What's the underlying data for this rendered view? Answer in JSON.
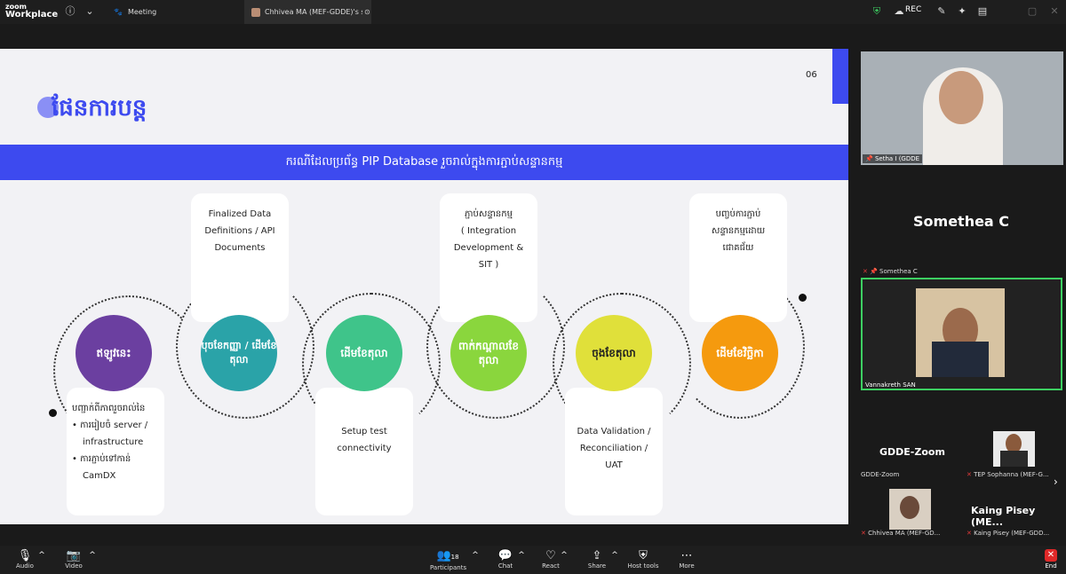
{
  "app": {
    "logo_line1": "zoom",
    "logo_line2": "Workplace"
  },
  "tabs": [
    {
      "label": "Meeting"
    },
    {
      "label": "Chhivea MA (MEF-GDDE)'s screer"
    }
  ],
  "rec_label": "REC",
  "slide": {
    "page_number": "06",
    "title": "ផែនការបន្ត",
    "banner": "ករណីដែលប្រព័ន្ធ PIP Database រួចរាល់ក្នុងការភ្ជាប់សន្ទានកម្ម",
    "steps": [
      {
        "circle": "ឥឡូវនេះ",
        "color": "#6b3fa0",
        "card": [
          "បញ្ជាក់ពីភាពរួចរាល់នៃ",
          "• ការរៀបចំ server /",
          "infrastructure",
          "• ការភ្ជាប់ទៅកាន់",
          "CamDX"
        ]
      },
      {
        "circle": "បុចខែកញ្ញា / ដើមខែតុលា",
        "color": "#2aa3a8",
        "card": [
          "Finalized Data",
          "Definitions / API",
          "Documents"
        ]
      },
      {
        "circle": "ដើមខែតុលា",
        "color": "#3fc48a",
        "card": [
          "Setup test",
          "connectivity"
        ]
      },
      {
        "circle": "ពាក់កណ្តាលខែតុលា",
        "color": "#8ad63d",
        "card": [
          "ភ្ជាប់សន្ទានកម្ម",
          "( Integration",
          "Development &",
          "SIT )"
        ]
      },
      {
        "circle": "ចុងខែតុលា",
        "color": "#e0e03a",
        "card": [
          "Data Validation /",
          "Reconciliation /",
          "UAT"
        ]
      },
      {
        "circle": "ដើមខែវិច្ឆិកា",
        "color": "#f59a0e",
        "card": [
          "បញ្ចប់ការភ្ជាប់",
          "សន្ទានកម្មដោយ",
          "ជោគជ័យ"
        ]
      }
    ]
  },
  "participants_panel": {
    "video1_name": "Setha I (GDDE",
    "big_name": "Somethea C",
    "somethea_label": "Somethea C",
    "video2_name": "Vannakreth SAN",
    "tile_gdde": "GDDE-Zoom",
    "tile_gdde_small": "GDDE-Zoom",
    "tep_label": "TEP Sophanna (MEF-G...",
    "chhivea_label": "Chhivea MA (MEF-GD...",
    "kaing_big": "Kaing Pisey (ME...",
    "kaing_small": "Kaing Pisey (MEF-GDD..."
  },
  "toolbar": {
    "audio": "Audio",
    "video": "Video",
    "participants": "Participants",
    "participants_count": "18",
    "chat": "Chat",
    "react": "React",
    "share": "Share",
    "host_tools": "Host tools",
    "more": "More",
    "end": "End"
  }
}
